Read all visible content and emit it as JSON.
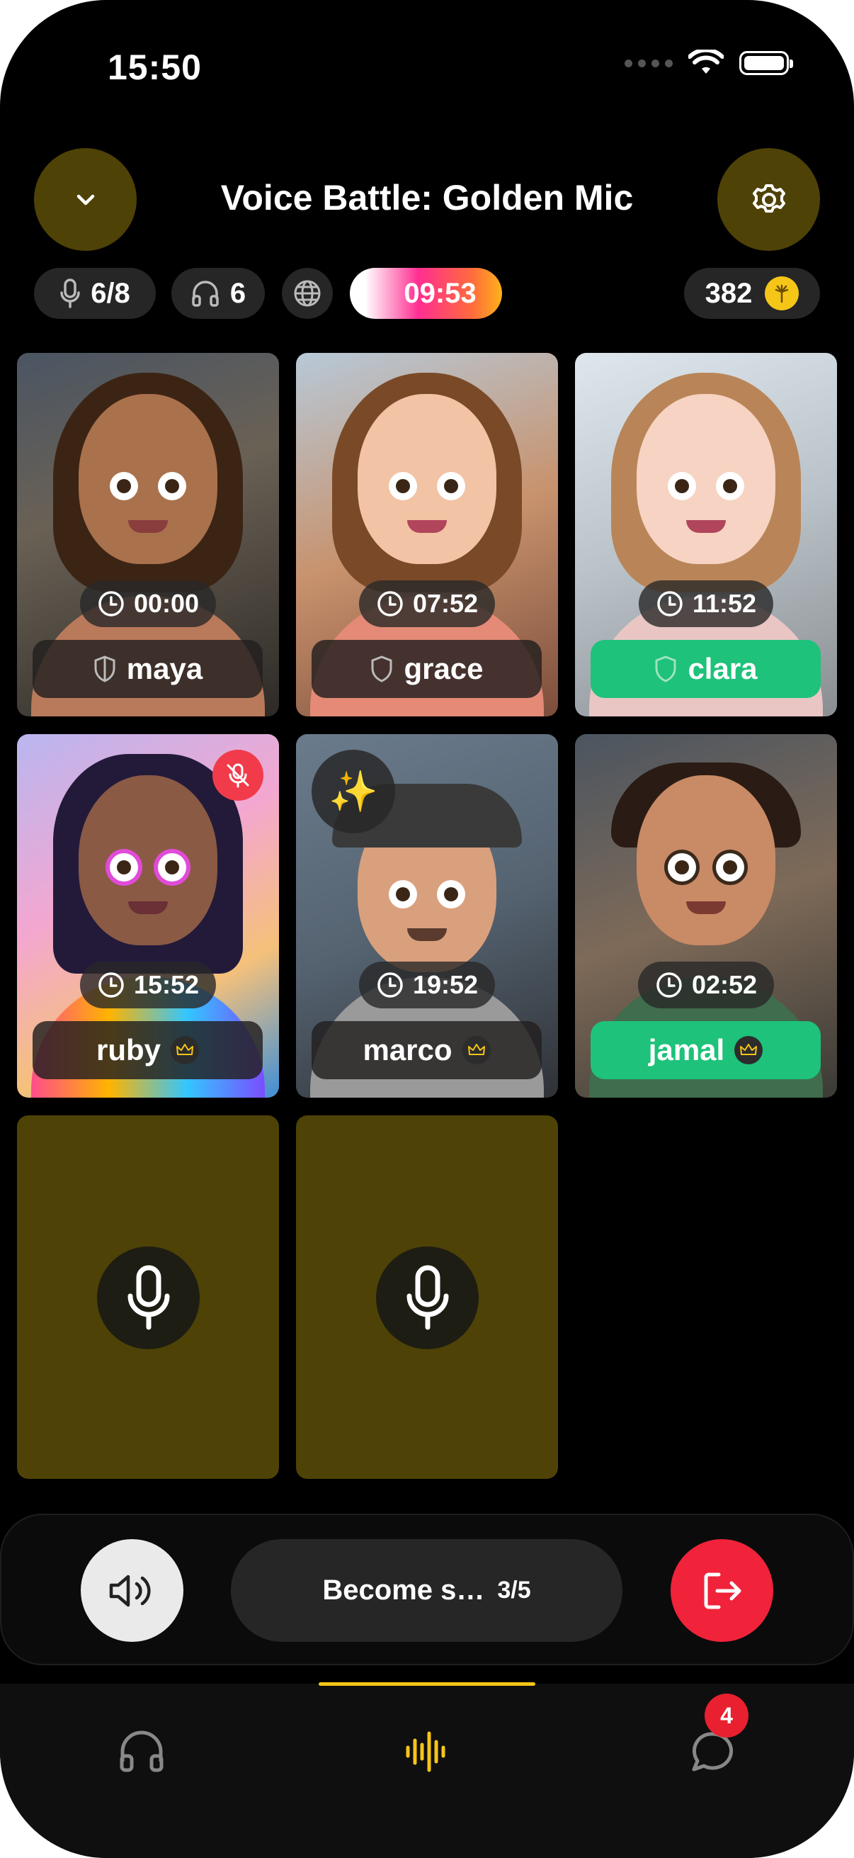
{
  "status_bar": {
    "time": "15:50"
  },
  "header": {
    "title": "Voice Battle: Golden Mic"
  },
  "stats": {
    "mic_count": "6/8",
    "listener_count": "6",
    "timer": "09:53",
    "coins": "382"
  },
  "seats": [
    {
      "name": "maya",
      "time": "00:00",
      "role": "shield",
      "active": false
    },
    {
      "name": "grace",
      "time": "07:52",
      "role": "shield",
      "active": false
    },
    {
      "name": "clara",
      "time": "11:52",
      "role": "shield",
      "active": true
    },
    {
      "name": "ruby",
      "time": "15:52",
      "role": "crown",
      "active": false,
      "muted": true
    },
    {
      "name": "marco",
      "time": "19:52",
      "role": "crown",
      "active": false,
      "effect": "✨"
    },
    {
      "name": "jamal",
      "time": "02:52",
      "role": "crown",
      "active": true
    }
  ],
  "controls": {
    "become_label": "Become s…",
    "become_count": "3/5"
  },
  "tabs": {
    "notification_count": "4",
    "active_tab": "voice"
  },
  "colors": {
    "accent": "#f5c518",
    "empty_seat": "#4f4206",
    "speaking": "#1ec27a",
    "leave": "#f0233a"
  },
  "icons": [
    "chevron-down-icon",
    "gear-icon",
    "mic-icon",
    "headphones-icon",
    "globe-icon",
    "coin-icon",
    "clock-icon",
    "shield-icon",
    "crown-icon",
    "mic-off-icon",
    "speaker-icon",
    "exit-icon",
    "waveform-icon",
    "chat-icon",
    "wifi-icon",
    "battery-icon"
  ]
}
